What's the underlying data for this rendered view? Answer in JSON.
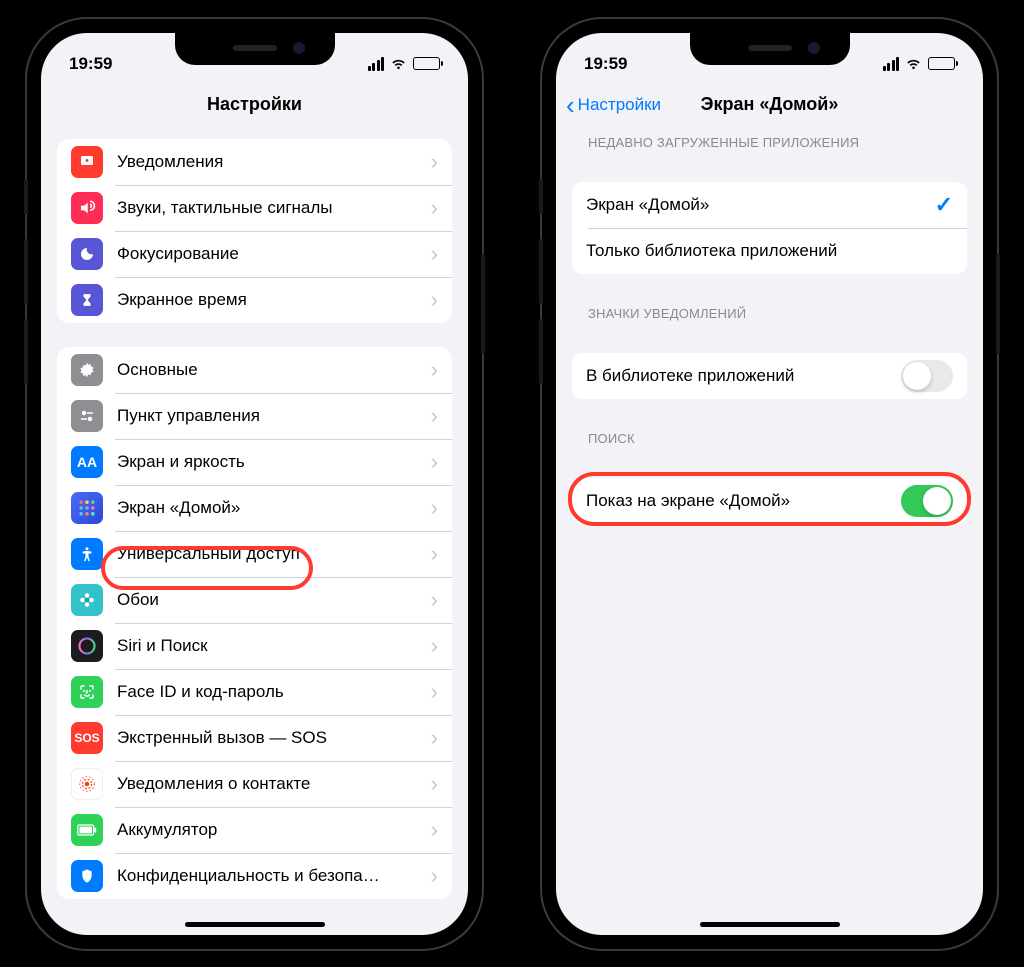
{
  "status": {
    "time": "19:59"
  },
  "phone1": {
    "title": "Настройки",
    "groups": [
      {
        "rows": [
          {
            "label": "Уведомления",
            "icon_bg": "#ff3b30",
            "icon": "bell"
          },
          {
            "label": "Звуки, тактильные сигналы",
            "icon_bg": "#ff2d55",
            "icon": "speaker"
          },
          {
            "label": "Фокусирование",
            "icon_bg": "#5856d6",
            "icon": "moon"
          },
          {
            "label": "Экранное время",
            "icon_bg": "#5856d6",
            "icon": "hourglass"
          }
        ]
      },
      {
        "rows": [
          {
            "label": "Основные",
            "icon_bg": "#8e8e93",
            "icon": "gear"
          },
          {
            "label": "Пункт управления",
            "icon_bg": "#8e8e93",
            "icon": "sliders"
          },
          {
            "label": "Экран и яркость",
            "icon_bg": "#007aff",
            "icon": "aa"
          },
          {
            "label": "Экран «Домой»",
            "icon_bg": "#3355dd",
            "icon": "grid",
            "highlighted": true
          },
          {
            "label": "Универсальный доступ",
            "icon_bg": "#007aff",
            "icon": "accessibility"
          },
          {
            "label": "Обои",
            "icon_bg": "#33c2c8",
            "icon": "flower"
          },
          {
            "label": "Siri и Поиск",
            "icon_bg": "#1c1c1e",
            "icon": "siri"
          },
          {
            "label": "Face ID и код-пароль",
            "icon_bg": "#30d158",
            "icon": "faceid"
          },
          {
            "label": "Экстренный вызов — SOS",
            "icon_bg": "#ff3b30",
            "icon": "sos"
          },
          {
            "label": "Уведомления о контакте",
            "icon_bg": "#ffffff",
            "icon": "exposure"
          },
          {
            "label": "Аккумулятор",
            "icon_bg": "#30d158",
            "icon": "battery"
          },
          {
            "label": "Конфиденциальность и безопа…",
            "icon_bg": "#007aff",
            "icon": "hand"
          }
        ]
      }
    ]
  },
  "phone2": {
    "back": "Настройки",
    "title": "Экран «Домой»",
    "sections": [
      {
        "header": "НЕДАВНО ЗАГРУЖЕННЫЕ ПРИЛОЖЕНИЯ",
        "rows": [
          {
            "label": "Экран «Домой»",
            "checked": true
          },
          {
            "label": "Только библиотека приложений",
            "checked": false
          }
        ]
      },
      {
        "header": "ЗНАЧКИ УВЕДОМЛЕНИЙ",
        "rows": [
          {
            "label": "В библиотеке приложений",
            "type": "switch",
            "on": false
          }
        ]
      },
      {
        "header": "ПОИСК",
        "rows": [
          {
            "label": "Показ на экране «Домой»",
            "type": "switch",
            "on": true,
            "highlighted": true
          }
        ]
      }
    ]
  }
}
